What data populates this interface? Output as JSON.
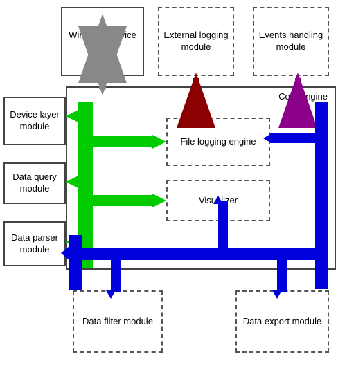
{
  "boxes": {
    "windows": "Windows service wrapper",
    "external": "External logging module",
    "events": "Events handling module",
    "core": "Core engine",
    "file_logging": "File logging engine",
    "visualizer": "Visualizer",
    "device": "Device layer module",
    "query": "Data query module",
    "parser": "Data parser module",
    "filter": "Data filter module",
    "export": "Data export module"
  }
}
